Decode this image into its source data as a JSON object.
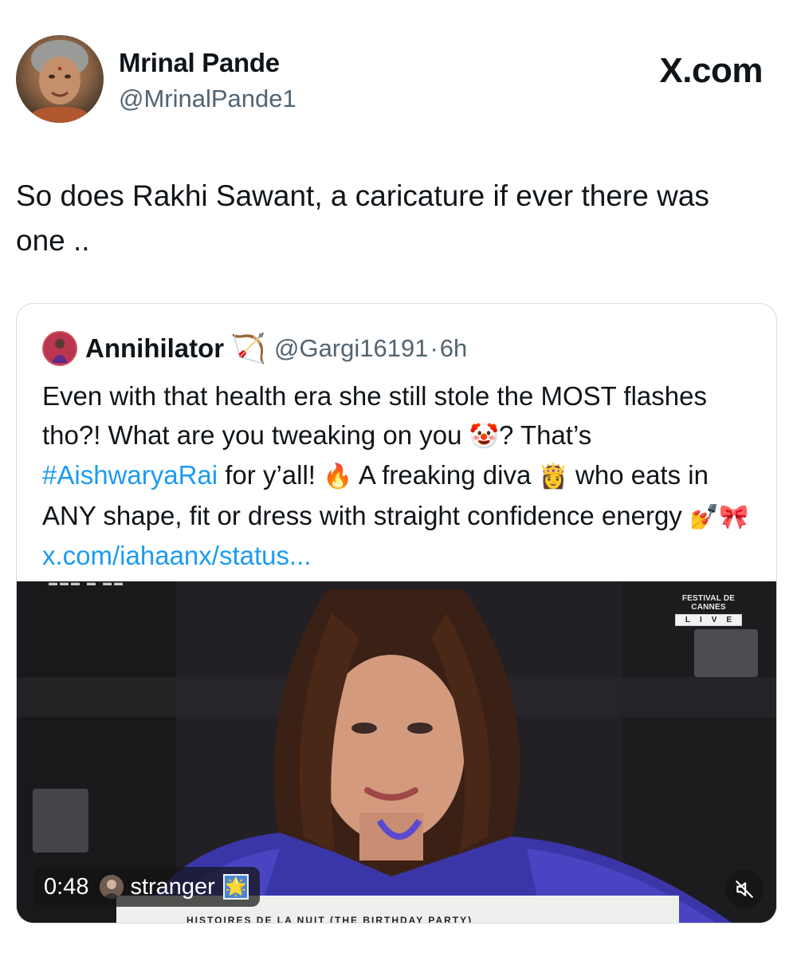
{
  "header": {
    "author_name": "Mrinal Pande",
    "author_handle": "@MrinalPande1",
    "site_logo": "X.com"
  },
  "tweet": {
    "text": "So does Rakhi Sawant, a caricature if ever there was one .."
  },
  "quote": {
    "name": "Annihilator",
    "badge_emoji": "🏹",
    "handle": "@Gargi16191",
    "separator": "·",
    "time": "6h",
    "text_part1": "Even with that health era she still stole the MOST flashes tho?! What are you tweaking on you ",
    "emoji_clown": "🤡",
    "text_part2": "? That’s ",
    "hashtag": "#AishwaryaRai",
    "text_part3": " for y’all! ",
    "emoji_fire": "🔥",
    "text_part4": " A freaking diva ",
    "emoji_princess": "👸",
    "text_part5": " who eats in ANY shape, fit or dress with straight confidence energy ",
    "emoji_nails": "💅",
    "emoji_ribbon": "🎀",
    "link": "x.com/iahaanx/status..."
  },
  "video": {
    "duration": "0:48",
    "uploader": "stranger",
    "uploader_badge": "🌟",
    "overlay_title": "FESTIVAL DE CANNES",
    "overlay_live": "LIVE",
    "banner_text": "HISTOIRES DE LA NUIT (THE BIRTHDAY PARTY)",
    "mute_icon": "speaker-muted-icon"
  },
  "colors": {
    "link": "#1d9bf0",
    "secondary_text": "#536471",
    "border": "#d7dde2"
  }
}
